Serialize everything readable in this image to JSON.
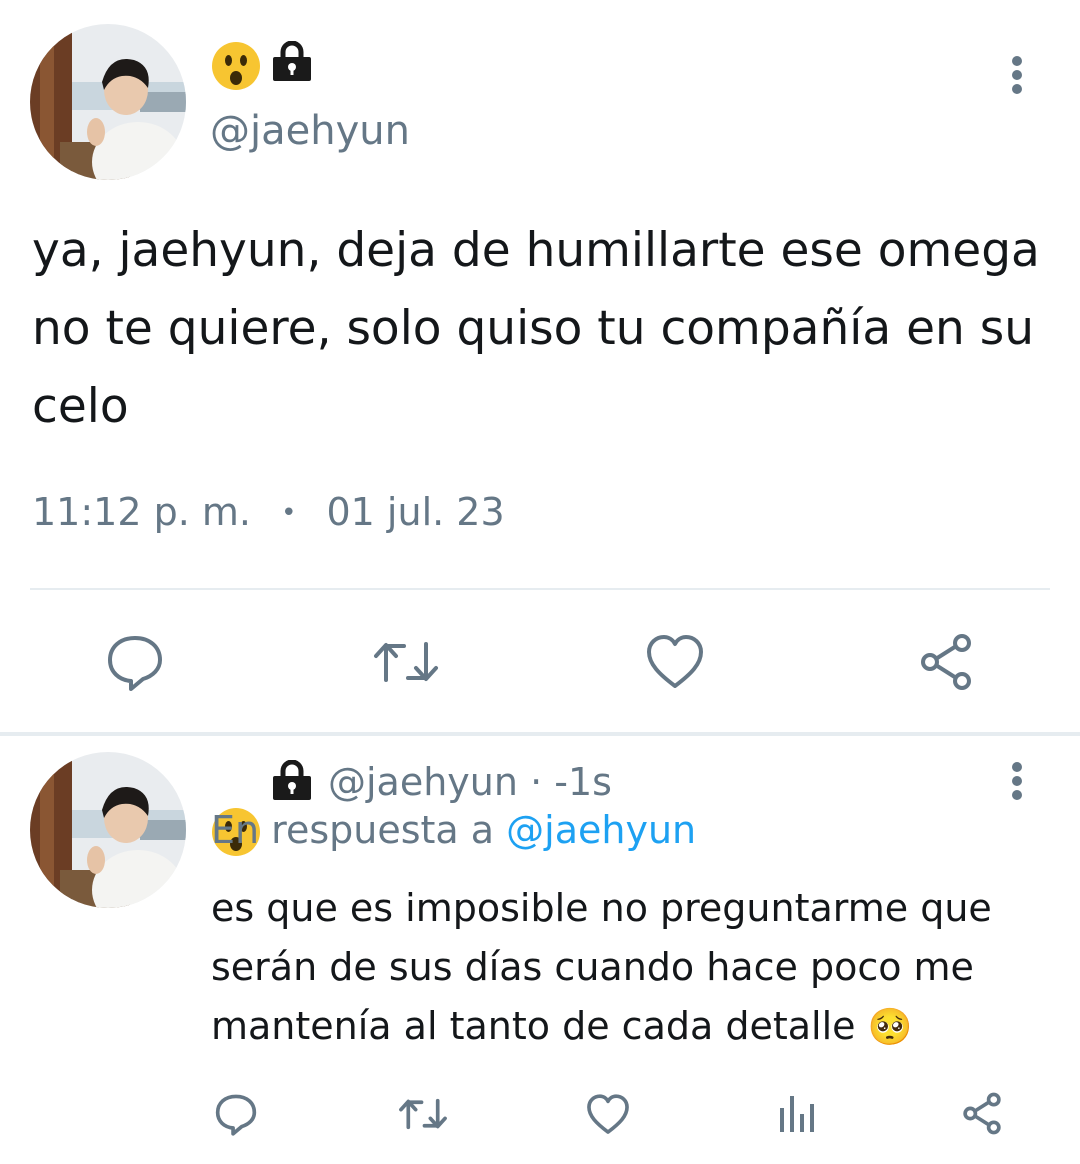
{
  "tweet": {
    "handle": "@jaehyun",
    "text": "ya, jaehyun, deja de humillarte ese omega no te quiere, solo quiso tu compañía en su celo",
    "time": "11:12 p. m.",
    "separator": "•",
    "date": "01 jul. 23",
    "actions": [
      "reply-icon",
      "retweet-icon",
      "like-icon",
      "share-icon"
    ]
  },
  "reply": {
    "handle": "@jaehyun",
    "dot": "·",
    "age": "-1s",
    "in_reply_prefix": "En respuesta a",
    "in_reply_handle": "@jaehyun",
    "text": "es que es imposible no preguntarme que serán de sus días cuando hace poco me mantenía al tanto de cada detalle",
    "text_emoji": "🥺",
    "actions": [
      "reply-icon",
      "retweet-icon",
      "like-icon",
      "stats-icon",
      "share-icon"
    ]
  },
  "colors": {
    "text": "#14171a",
    "muted": "#657786",
    "link": "#1da1f2",
    "divider": "#e6ecf0",
    "emoji": "#f7c531"
  }
}
